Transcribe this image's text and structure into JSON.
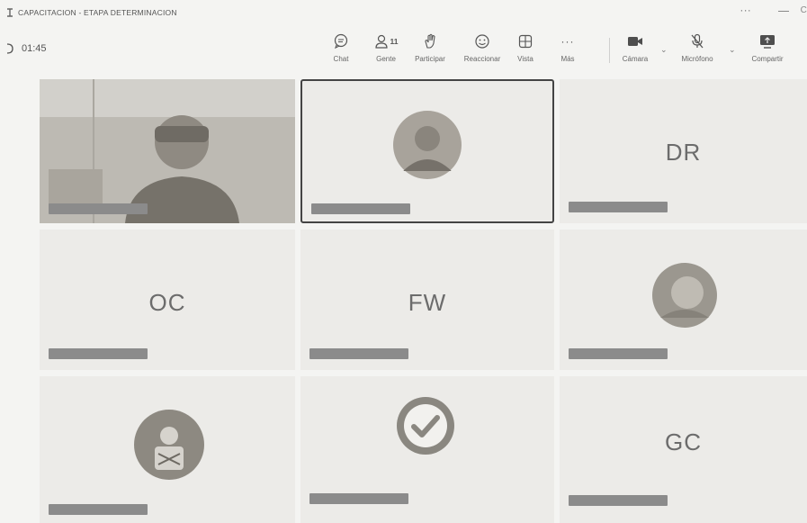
{
  "window": {
    "title": "CAPACITACION - ETAPA DETERMINACION",
    "more_icon": "more-icon",
    "minimize_icon": "minimize-icon",
    "close_icon": "close-icon"
  },
  "timer": {
    "value": "01:45"
  },
  "toolbar": {
    "buttons": [
      {
        "label": "Chat",
        "icon": "chat-icon"
      },
      {
        "label": "Gente",
        "icon": "people-icon",
        "count": "11"
      },
      {
        "label": "Participar",
        "icon": "raise-hand-icon"
      },
      {
        "label": "Reaccionar",
        "icon": "smiley-icon"
      },
      {
        "label": "Vista",
        "icon": "view-grid-icon"
      },
      {
        "label": "Más",
        "icon": "more-icon"
      },
      {
        "label": "Cámara",
        "icon": "camera-icon"
      },
      {
        "label": "Micrófono",
        "icon": "microphone-off-icon"
      },
      {
        "label": "Compartir",
        "icon": "share-screen-icon"
      }
    ]
  },
  "tiles": [
    {
      "type": "video",
      "name": ""
    },
    {
      "type": "avatar",
      "name": "",
      "active": true
    },
    {
      "type": "initials",
      "initials": "DR",
      "name": ""
    },
    {
      "type": "initials",
      "initials": "OC",
      "name": ""
    },
    {
      "type": "initials",
      "initials": "FW",
      "name": ""
    },
    {
      "type": "avatar",
      "name": ""
    },
    {
      "type": "avatar",
      "name": ""
    },
    {
      "type": "avatar",
      "name": ""
    },
    {
      "type": "initials",
      "initials": "GC",
      "name": ""
    }
  ],
  "colors": {
    "background": "#f4f4f2",
    "tile": "#ecebe8",
    "name_tag": "#8b8b8b",
    "active_border": "#444444"
  }
}
